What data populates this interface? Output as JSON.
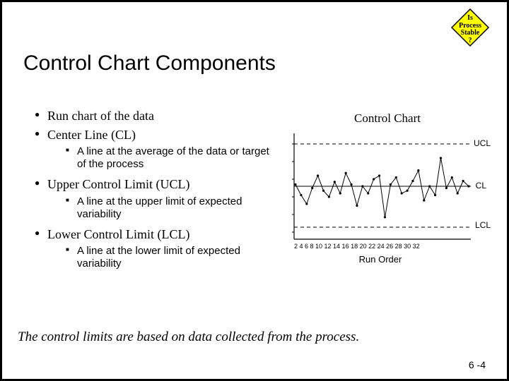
{
  "badge": {
    "l1": "Is",
    "l2": "Process",
    "l3": "Stable",
    "l4": "?"
  },
  "title": "Control Chart Components",
  "bullets": {
    "b1": "Run chart of the data",
    "b2": "Center Line (CL)",
    "b2s": "A line at the average of the data or target of the process",
    "b3": "Upper Control Limit (UCL)",
    "b3s": "A line at the upper limit of expected variability",
    "b4": "Lower Control Limit (LCL)",
    "b4s": "A line at the lower limit of expected variability"
  },
  "chart": {
    "title": "Control Chart",
    "ucl": "UCL",
    "cl": "CL",
    "lcl": "LCL",
    "xlabel": "Run Order",
    "xticks": "2  4  6  8 10 12 14 16 18 20 22 24 26 28 30 32"
  },
  "footnote": "The control limits are based on data collected from the process.",
  "pagenum": "6 -4",
  "chart_data": {
    "type": "line",
    "title": "Control Chart",
    "xlabel": "Run Order",
    "ylabel": "",
    "x": [
      1,
      2,
      3,
      4,
      5,
      6,
      7,
      8,
      9,
      10,
      11,
      12,
      13,
      14,
      15,
      16,
      17,
      18,
      19,
      20,
      21,
      22,
      23,
      24,
      25,
      26,
      27,
      28,
      29,
      30,
      31,
      32
    ],
    "values": [
      82,
      70,
      60,
      78,
      92,
      75,
      68,
      85,
      72,
      95,
      82,
      58,
      80,
      72,
      88,
      92,
      45,
      82,
      90,
      72,
      75,
      86,
      98,
      64,
      80,
      70,
      112,
      78,
      90,
      72,
      86,
      80
    ],
    "reference_lines": {
      "UCL": 125,
      "CL": 80,
      "LCL": 30
    },
    "ylim": [
      20,
      140
    ]
  }
}
